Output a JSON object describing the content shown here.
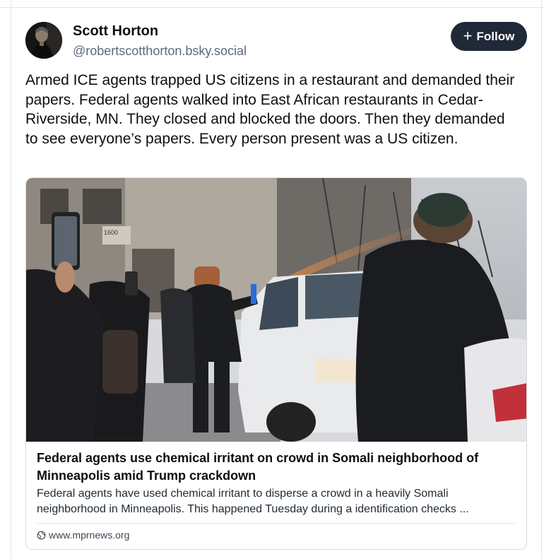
{
  "post": {
    "author": {
      "name": "Scott Horton",
      "handle": "@robertscotthorton.bsky.social"
    },
    "follow_label": "Follow",
    "follow_icon": "plus-icon",
    "text": "Armed ICE agents trapped US citizens in a restaurant and demanded their papers. Federal agents walked into East African restaurants in Cedar-Riverside, MN. They closed and blocked the doors. Then they demanded to see everyone’s papers. Every person present was a US citizen."
  },
  "link_card": {
    "title": "Federal agents use chemical irritant on crowd in Somali neighborhood of Minneapolis amid Trump crackdown",
    "description_line1": "Federal agents have used chemical irritant to disperse a crowd in a heavily Somali",
    "description_line2": "neighborhood in Minneapolis. This happened Tuesday during a identification checks ...",
    "domain": "www.mprnews.org",
    "domain_icon": "globe-icon",
    "image_building_number": "1600"
  },
  "colors": {
    "follow_bg": "#1f2937",
    "text": "#0b0f14",
    "muted": "#5b6b7c",
    "border": "#d4dbe2"
  }
}
